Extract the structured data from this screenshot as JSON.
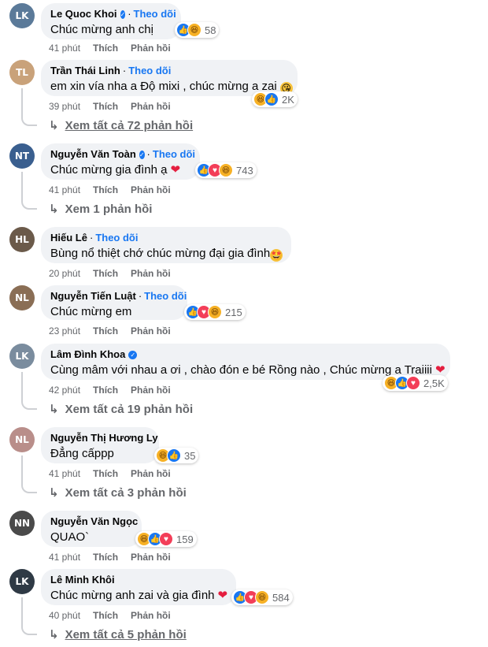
{
  "colors": {
    "link": "#1877f2",
    "bubble": "#f0f2f5",
    "meta": "#65676b"
  },
  "labels": {
    "like": "Thích",
    "reply": "Phản hồi",
    "follow": "Theo dõi"
  },
  "comments": [
    {
      "name": "Le Quoc Khoi",
      "verified": true,
      "follow": true,
      "text": "Chúc mừng anh chị",
      "time": "41 phút",
      "reactions": [
        "like",
        "haha"
      ],
      "count": "58",
      "replies": ""
    },
    {
      "name": "Trần Thái Linh",
      "verified": false,
      "follow": true,
      "text": "em xin vía nha a Độ mixi , chúc mừng a zai",
      "time": "39 phút",
      "reactions": [
        "haha",
        "like"
      ],
      "count": "2K",
      "replies": "Xem tất cả 72 phản hồi"
    },
    {
      "name": "Nguyễn Văn Toàn",
      "verified": true,
      "follow": true,
      "text": "Chúc mừng gia đình ạ",
      "time": "41 phút",
      "reactions": [
        "like",
        "love",
        "haha"
      ],
      "count": "743",
      "replies": "Xem 1 phản hồi"
    },
    {
      "name": "Hiếu Lê",
      "verified": false,
      "follow": true,
      "text": "Bùng nổ thiệt chớ chúc mừng đại gia đình",
      "time": "20 phút",
      "reactions": [],
      "count": "",
      "replies": ""
    },
    {
      "name": "Nguyễn Tiến Luật",
      "verified": false,
      "follow": true,
      "text": "Chúc mừng em",
      "time": "23 phút",
      "reactions": [
        "like",
        "love",
        "haha"
      ],
      "count": "215",
      "replies": ""
    },
    {
      "name": "Lâm Đình Khoa",
      "verified": true,
      "follow": false,
      "text": "Cùng mâm với nhau a ơi , chào đón e bé Rồng nào , Chúc mừng a Traiiii",
      "time": "42 phút",
      "reactions": [
        "haha",
        "like",
        "love"
      ],
      "count": "2,5K",
      "replies": "Xem tất cả 19 phản hồi"
    },
    {
      "name": "Nguyễn Thị Hương Ly",
      "verified": false,
      "follow": false,
      "text": "Đẳng cấppp",
      "time": "41 phút",
      "reactions": [
        "haha",
        "like"
      ],
      "count": "35",
      "replies": "Xem tất cả 3 phản hồi"
    },
    {
      "name": "Nguyễn Văn Ngọc",
      "verified": false,
      "follow": false,
      "text": "QUAO`",
      "time": "41 phút",
      "reactions": [
        "haha",
        "like",
        "love"
      ],
      "count": "159",
      "replies": ""
    },
    {
      "name": "Lê Minh Khôi",
      "verified": false,
      "follow": false,
      "text": "Chúc mừng anh zai và gia đình",
      "time": "40 phút",
      "reactions": [
        "like",
        "love",
        "haha"
      ],
      "count": "584",
      "replies": "Xem tất cả 5 phản hồi"
    }
  ]
}
